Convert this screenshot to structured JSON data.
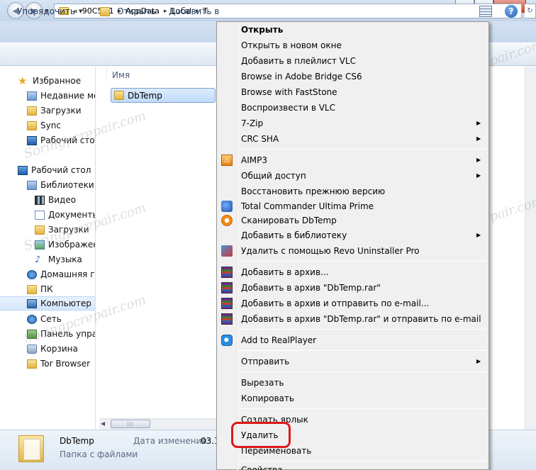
{
  "window": {
    "title_buttons": [
      "minimize-icon",
      "maximize-icon",
      "close-icon"
    ]
  },
  "address_bar": {
    "crumbs": [
      "«",
      "90C5~1",
      "AppData",
      "Local",
      "T"
    ]
  },
  "toolbar": {
    "organize_label": "Упорядочить",
    "open_label": "Открыть",
    "add_label": "Добавить в"
  },
  "sidebar": {
    "items": [
      {
        "label": "Избранное",
        "icon": "star-icon"
      },
      {
        "label": "Недавние мест",
        "icon": "recent-places-icon"
      },
      {
        "label": "Загрузки",
        "icon": "downloads-folder-icon"
      },
      {
        "label": "Sync",
        "icon": "folder-icon"
      },
      {
        "label": "Рабочий стол",
        "icon": "desktop-icon"
      },
      {
        "label": "Рабочий стол",
        "icon": "desktop-icon"
      },
      {
        "label": "Библиотеки",
        "icon": "libraries-icon"
      },
      {
        "label": "Видео",
        "icon": "video-icon"
      },
      {
        "label": "Документы",
        "icon": "documents-icon"
      },
      {
        "label": "Загрузки",
        "icon": "downloads-folder-icon"
      },
      {
        "label": "Изображени",
        "icon": "pictures-icon"
      },
      {
        "label": "Музыка",
        "icon": "music-icon"
      },
      {
        "label": "Домашняя гру",
        "icon": "homegroup-icon"
      },
      {
        "label": "ПК",
        "icon": "folder-icon"
      },
      {
        "label": "Компьютер",
        "icon": "computer-icon"
      },
      {
        "label": "Сеть",
        "icon": "network-icon"
      },
      {
        "label": "Панель управ",
        "icon": "control-panel-icon"
      },
      {
        "label": "Корзина",
        "icon": "recycle-bin-icon"
      },
      {
        "label": "Tor Browser",
        "icon": "folder-icon"
      }
    ]
  },
  "content": {
    "column_name": "Имя",
    "file_name": "DbTemp"
  },
  "details": {
    "name": "DbTemp",
    "type": "Папка с файлами",
    "date_label": "Дата изменения:",
    "date_value": "03.1."
  },
  "context_menu": {
    "items": [
      {
        "label": "Открыть",
        "bold": true
      },
      {
        "label": "Открыть в новом окне"
      },
      {
        "label": "Добавить в плейлист VLC"
      },
      {
        "label": "Browse in Adobe Bridge CS6"
      },
      {
        "label": "Browse with FastStone"
      },
      {
        "label": "Воспроизвести в VLC"
      },
      {
        "label": "7-Zip",
        "submenu": true
      },
      {
        "label": "CRC SHA",
        "submenu": true
      },
      {
        "label": "AIMP3",
        "submenu": true,
        "icon": "aimp-icon"
      },
      {
        "label": "Общий доступ",
        "submenu": true
      },
      {
        "label": "Восстановить прежнюю версию"
      },
      {
        "label": "Total Commander Ultima Prime",
        "icon": "total-commander-icon"
      },
      {
        "label": "Сканировать DbTemp",
        "icon": "avast-icon"
      },
      {
        "label": "Добавить в библиотеку",
        "submenu": true
      },
      {
        "label": "Удалить с помощью Revo Uninstaller Pro",
        "icon": "revo-uninstaller-icon"
      },
      {
        "label": "Добавить в архив...",
        "icon": "winrar-icon"
      },
      {
        "label": "Добавить в архив \"DbTemp.rar\"",
        "icon": "winrar-icon"
      },
      {
        "label": "Добавить в архив и отправить по e-mail...",
        "icon": "winrar-icon"
      },
      {
        "label": "Добавить в архив \"DbTemp.rar\" и отправить по e-mail",
        "icon": "winrar-icon"
      },
      {
        "label": "Add to RealPlayer",
        "icon": "realplayer-icon"
      },
      {
        "label": "Отправить",
        "submenu": true
      },
      {
        "label": "Вырезать"
      },
      {
        "label": "Копировать"
      },
      {
        "label": "Создать ярлык"
      },
      {
        "label": "Удалить"
      },
      {
        "label": "Переименовать"
      },
      {
        "label": "Свойства"
      }
    ]
  },
  "annotation": {
    "highlight_color": "#e01818",
    "highlighted_item": "Удалить"
  },
  "watermark": {
    "text": "Soringpcrepair.com"
  }
}
